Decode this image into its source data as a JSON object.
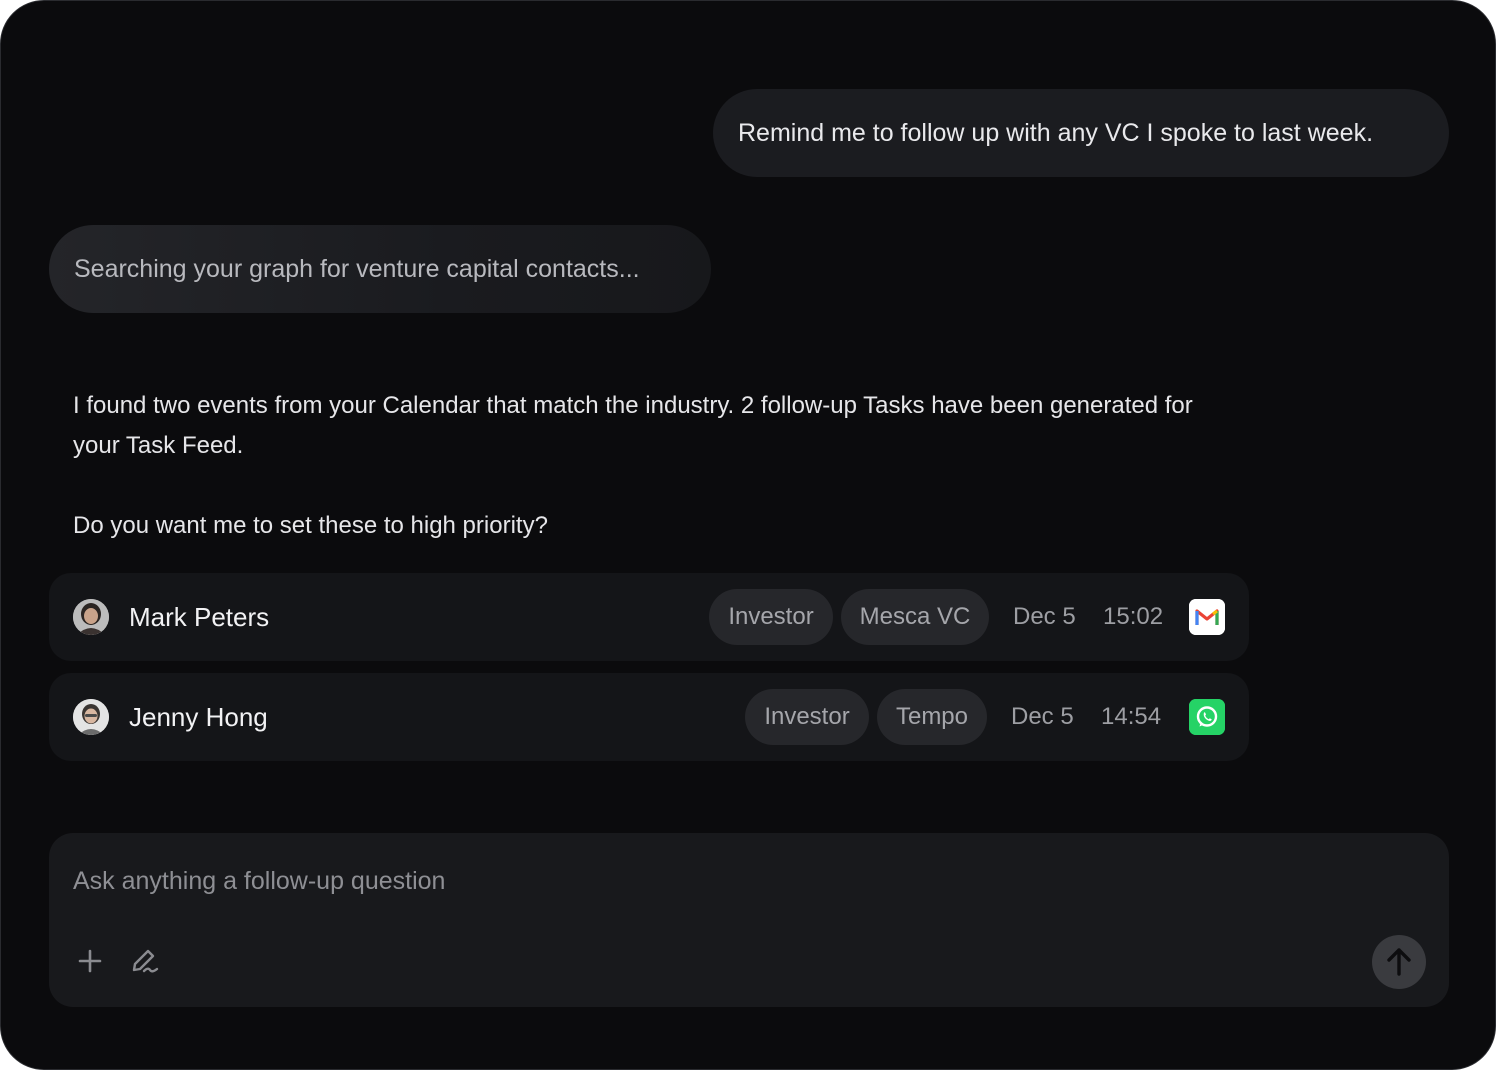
{
  "conversation": {
    "user_message": "Remind me to follow up with any VC I spoke to last week.",
    "status_message": "Searching your graph for venture capital contacts...",
    "reply_paragraphs": [
      "I found two events from your Calendar that match the industry. 2 follow-up Tasks have been generated for your Task Feed.",
      "Do you want me to set these to high priority?"
    ]
  },
  "contacts": [
    {
      "name": "Mark Peters",
      "tags": [
        "Investor",
        "Mesca VC"
      ],
      "date": "Dec 5",
      "time": "15:02",
      "source_icon": "gmail-icon"
    },
    {
      "name": "Jenny Hong",
      "tags": [
        "Investor",
        "Tempo"
      ],
      "date": "Dec 5",
      "time": "14:54",
      "source_icon": "whatsapp-icon"
    }
  ],
  "composer": {
    "placeholder": "Ask anything a follow-up question",
    "value": "",
    "add_icon": "plus-icon",
    "draw_icon": "pen-icon",
    "send_icon": "arrow-up-icon"
  },
  "colors": {
    "background": "#0b0b0d",
    "bubble": "#1b1c20",
    "row": "#141518",
    "tag": "#26272b",
    "gmail_red": "#ea4335",
    "whatsapp_green": "#25d366"
  }
}
